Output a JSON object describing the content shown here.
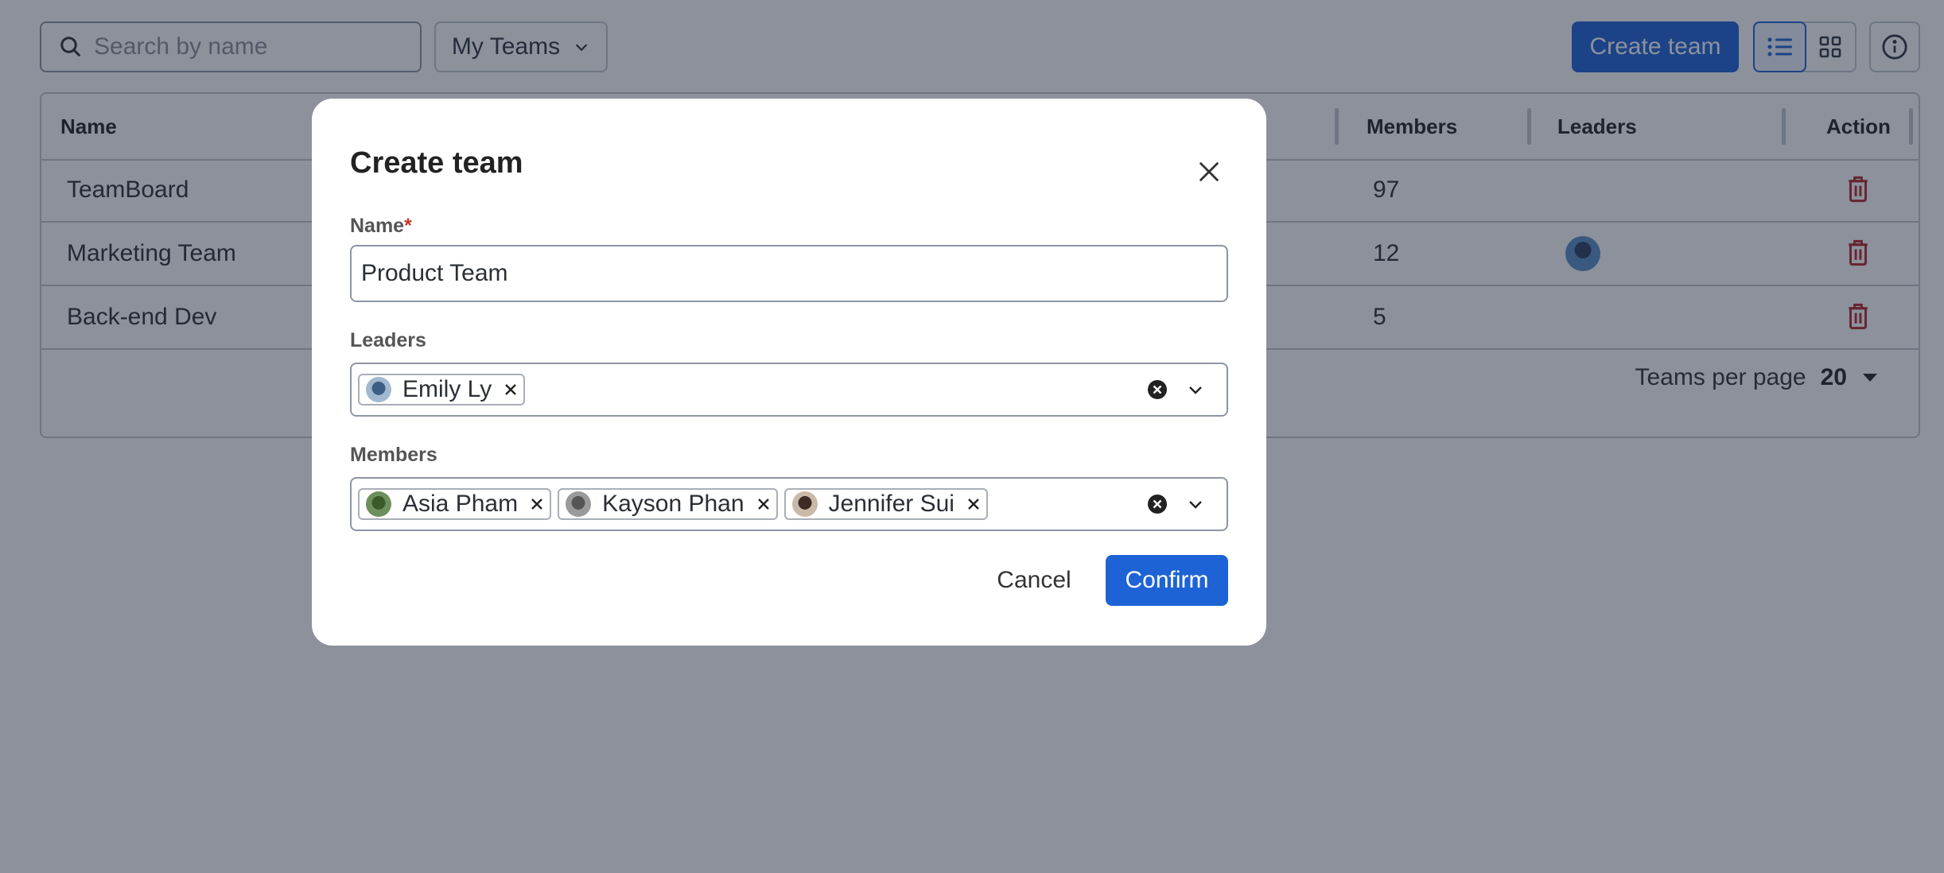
{
  "toolbar": {
    "search_placeholder": "Search by name",
    "filter_label": "My Teams",
    "create_label": "Create team"
  },
  "table": {
    "columns": {
      "name": "Name",
      "members": "Members",
      "leaders": "Leaders",
      "action": "Action"
    },
    "rows": [
      {
        "name": "TeamBoard",
        "members": "97",
        "has_leader_avatar": false
      },
      {
        "name": "Marketing Team",
        "members": "12",
        "has_leader_avatar": true
      },
      {
        "name": "Back-end Dev",
        "members": "5",
        "has_leader_avatar": false
      }
    ],
    "pagination": {
      "label": "Teams per page",
      "per_page": "20"
    }
  },
  "modal": {
    "title": "Create team",
    "name_label": "Name",
    "required_mark": "*",
    "name_value": "Product Team",
    "leaders_label": "Leaders",
    "leaders": [
      "Emily Ly"
    ],
    "members_label": "Members",
    "members": [
      "Asia Pham",
      "Kayson Phan",
      "Jennifer Sui"
    ],
    "cancel_label": "Cancel",
    "confirm_label": "Confirm"
  },
  "icons": {
    "search": "search-icon",
    "chevron": "chevron-down-icon",
    "list_view": "list-view-icon",
    "grid_view": "grid-view-icon",
    "info": "info-icon",
    "trash": "trash-icon",
    "close": "close-icon",
    "clear": "clear-circle-icon"
  },
  "colors": {
    "primary": "#1e63d6",
    "danger": "#b3262b",
    "overlay": "rgba(25,35,55,0.50)"
  }
}
